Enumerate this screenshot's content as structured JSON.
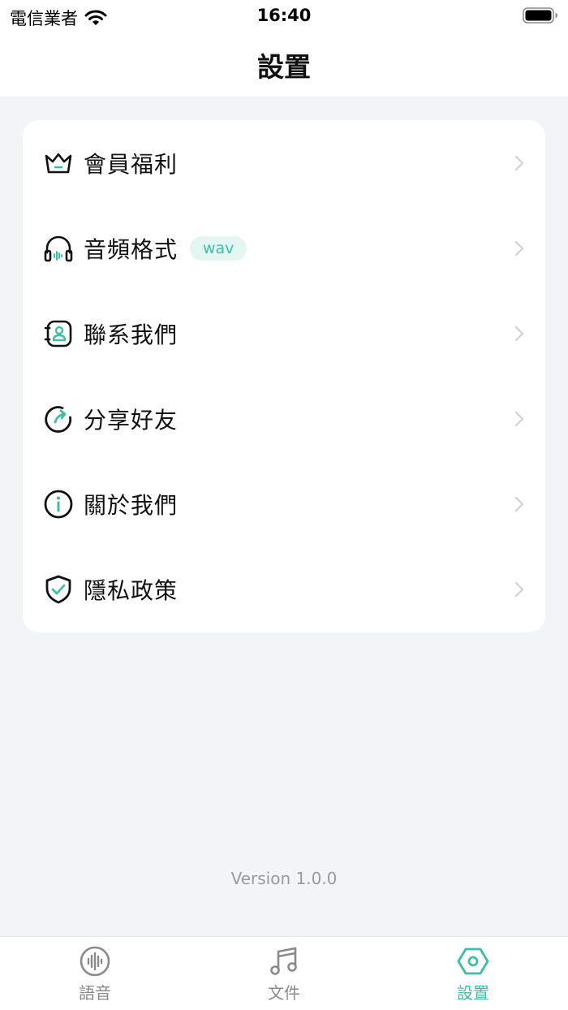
{
  "status_bar": {
    "carrier": "電信業者",
    "time": "16:40"
  },
  "header": {
    "title": "設置"
  },
  "settings": {
    "items": [
      {
        "icon": "crown-icon",
        "label": "會員福利"
      },
      {
        "icon": "headphones-icon",
        "label": "音頻格式",
        "badge": "wav"
      },
      {
        "icon": "contact-icon",
        "label": "聯系我們"
      },
      {
        "icon": "share-icon",
        "label": "分享好友"
      },
      {
        "icon": "info-icon",
        "label": "關於我們"
      },
      {
        "icon": "shield-check-icon",
        "label": "隱私政策"
      }
    ]
  },
  "footer": {
    "version": "Version 1.0.0"
  },
  "tabbar": {
    "tabs": [
      {
        "icon": "voice-icon",
        "label": "語音",
        "active": false
      },
      {
        "icon": "music-note-icon",
        "label": "文件",
        "active": false
      },
      {
        "icon": "settings-icon",
        "label": "設置",
        "active": true
      }
    ]
  },
  "colors": {
    "accent": "#3fbda5",
    "background": "#f3f4f8",
    "card": "#ffffff"
  }
}
